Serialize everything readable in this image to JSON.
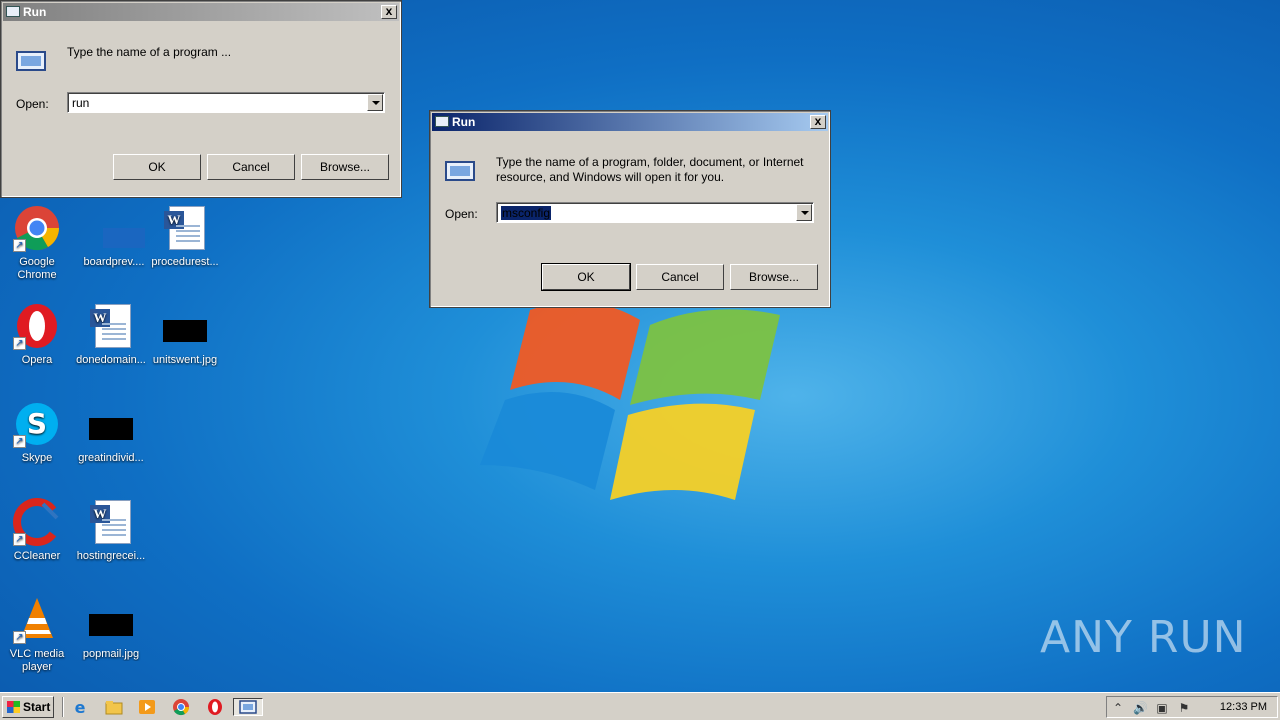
{
  "desktop": {
    "icons": [
      {
        "label": "Google Chrome",
        "label2": "Chrome",
        "label1": "Google"
      },
      {
        "label": "boardprev...."
      },
      {
        "label": "procedurest..."
      },
      {
        "label": "Opera"
      },
      {
        "label": "donedomain..."
      },
      {
        "label": "unitswent.jpg"
      },
      {
        "label": "Skype"
      },
      {
        "label": "greatindivid..."
      },
      {
        "label": "CCleaner"
      },
      {
        "label": "hostingrecei..."
      },
      {
        "label1": "VLC media",
        "label2": "player"
      },
      {
        "label": "popmail.jpg"
      }
    ],
    "watermark": "ANY RUN"
  },
  "run_dialog_back": {
    "title": "Run",
    "description": "Type the name of a program ...",
    "open_label": "Open:",
    "open_value": "run",
    "ok": "OK",
    "cancel": "Cancel",
    "browse": "Browse...",
    "close": "x",
    "title_color": "#ffffff"
  },
  "run_dialog_front": {
    "title": "Run",
    "description_line1": "Type the name of a program, folder, document, or Internet",
    "description_line2": "resource, and Windows will open it for you.",
    "open_label": "Open:",
    "open_value": "msconfig",
    "ok": "OK",
    "cancel": "Cancel",
    "browse": "Browse...",
    "close": "x",
    "title_gradient_start": "#0a246a",
    "title_gradient_end": "#a6caf0"
  },
  "taskbar": {
    "start_label": "Start",
    "clock": "12:33 PM",
    "quick_launch": [
      "internet-explorer-icon",
      "folder-icon",
      "media-player-icon",
      "chrome-icon",
      "opera-icon",
      "run-icon"
    ],
    "tray": [
      "show-hidden-icon",
      "volume-icon",
      "network-icon",
      "action-center-flag-icon"
    ]
  }
}
